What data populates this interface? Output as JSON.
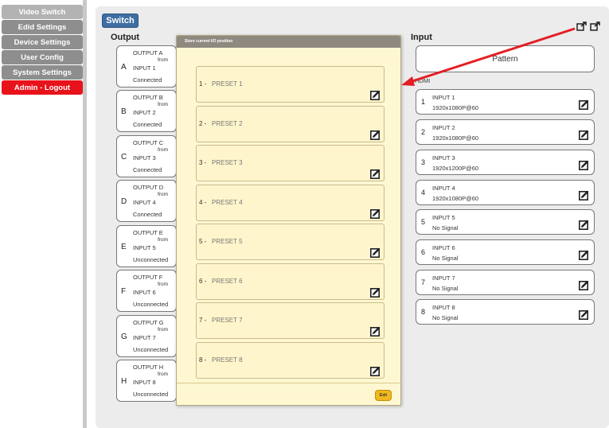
{
  "sidebar": {
    "items": [
      {
        "label": "Video Switch"
      },
      {
        "label": "Edid Settings"
      },
      {
        "label": "Device Settings"
      },
      {
        "label": "User Config"
      },
      {
        "label": "System Settings"
      },
      {
        "label": "Admin - Logout"
      }
    ]
  },
  "tabs": {
    "switch": "Switch"
  },
  "headings": {
    "output": "Output",
    "input": "Input"
  },
  "outputs": [
    {
      "letter": "A",
      "name": "OUTPUT A",
      "from": "from",
      "input": "INPUT 1",
      "status": "Connected"
    },
    {
      "letter": "B",
      "name": "OUTPUT B",
      "from": "from",
      "input": "INPUT 2",
      "status": "Connected"
    },
    {
      "letter": "C",
      "name": "OUTPUT C",
      "from": "from",
      "input": "INPUT 3",
      "status": "Connected"
    },
    {
      "letter": "D",
      "name": "OUTPUT D",
      "from": "from",
      "input": "INPUT 4",
      "status": "Connected"
    },
    {
      "letter": "E",
      "name": "OUTPUT E",
      "from": "from",
      "input": "INPUT 5",
      "status": "Unconnected"
    },
    {
      "letter": "F",
      "name": "OUTPUT F",
      "from": "from",
      "input": "INPUT 6",
      "status": "Unconnected"
    },
    {
      "letter": "G",
      "name": "OUTPUT G",
      "from": "from",
      "input": "INPUT 7",
      "status": "Unconnected"
    },
    {
      "letter": "H",
      "name": "OUTPUT H",
      "from": "from",
      "input": "INPUT 8",
      "status": "Unconnected"
    }
  ],
  "input_panel": {
    "pattern_label": "Pattern",
    "hdmi_label": "HDMI",
    "inputs": [
      {
        "num": "1",
        "name": "INPUT 1",
        "signal": "1920x1080P@60"
      },
      {
        "num": "2",
        "name": "INPUT 2",
        "signal": "1920x1080P@60"
      },
      {
        "num": "3",
        "name": "INPUT 3",
        "signal": "1920x1200P@60"
      },
      {
        "num": "4",
        "name": "INPUT 4",
        "signal": "1920x1080P@60"
      },
      {
        "num": "5",
        "name": "INPUT 5",
        "signal": "No Signal"
      },
      {
        "num": "6",
        "name": "INPUT 6",
        "signal": "No Signal"
      },
      {
        "num": "7",
        "name": "INPUT 7",
        "signal": "No Signal"
      },
      {
        "num": "8",
        "name": "INPUT 8",
        "signal": "No Signal"
      }
    ]
  },
  "modal": {
    "title": "Store current I/O position",
    "presets": [
      {
        "num": "1 -",
        "name": "PRESET 1"
      },
      {
        "num": "2 -",
        "name": "PRESET 2"
      },
      {
        "num": "3 -",
        "name": "PRESET 3"
      },
      {
        "num": "4 -",
        "name": "PRESET 4"
      },
      {
        "num": "5 -",
        "name": "PRESET 5"
      },
      {
        "num": "6 -",
        "name": "PRESET 6"
      },
      {
        "num": "7 -",
        "name": "PRESET 7"
      },
      {
        "num": "8 -",
        "name": "PRESET 8"
      }
    ],
    "exit_label": "Exit"
  },
  "colors": {
    "accent": "#3f6ea3",
    "logout": "#e8121b",
    "arrow": "#e31e24",
    "modal_bg": "#fff7d2"
  },
  "icons": [
    "edit-icon",
    "external-link-icon"
  ]
}
